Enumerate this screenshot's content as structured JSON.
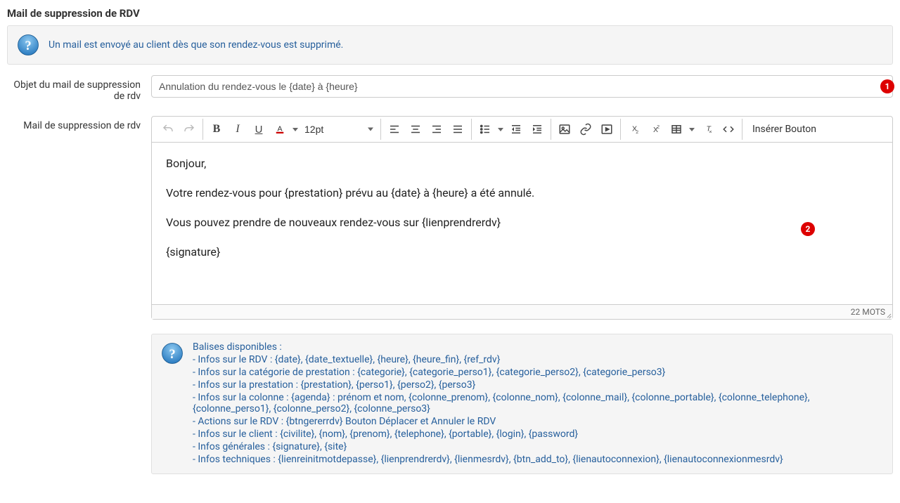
{
  "section_title": "Mail de suppression de RDV",
  "info1": "Un mail est envoyé au client dès que son rendez-vous est supprimé.",
  "labels": {
    "subject": "Objet du mail de suppression de rdv",
    "body": "Mail de suppression de rdv"
  },
  "subject_value": "Annulation du rendez-vous le {date} à {heure}",
  "editor": {
    "fontsize": "12pt",
    "insert_button": "Insérer Bouton",
    "content": {
      "p1": "Bonjour,",
      "p2": "Votre rendez-vous pour {prestation} prévu au {date} à {heure} a été annulé.",
      "p3": "Vous pouvez prendre de nouveaux rendez-vous sur {lienprendrerdv}",
      "p4": "{signature}"
    },
    "wordcount": "22 MOTS"
  },
  "badges": {
    "one": "1",
    "two": "2"
  },
  "tags": {
    "title": "Balises disponibles :",
    "l1": "- Infos sur le RDV : {date}, {date_textuelle}, {heure}, {heure_fin}, {ref_rdv}",
    "l2": "- Infos sur la catégorie de prestation : {categorie}, {categorie_perso1}, {categorie_perso2}, {categorie_perso3}",
    "l3": "- Infos sur la prestation : {prestation}, {perso1}, {perso2}, {perso3}",
    "l4": "- Infos sur la colonne : {agenda} : prénom et nom, {colonne_prenom}, {colonne_nom}, {colonne_mail}, {colonne_portable}, {colonne_telephone}, {colonne_perso1}, {colonne_perso2}, {colonne_perso3}",
    "l5": "- Actions sur le RDV : {btngererrdv} Bouton Déplacer et Annuler le RDV",
    "l6": "- Infos sur le client : {civilite}, {nom}, {prenom}, {telephone}, {portable}, {login}, {password}",
    "l7": "- Infos générales : {signature}, {site}",
    "l8": "- Infos techniques : {lienreinitmotdepasse}, {lienprendrerdv}, {lienmesrdv}, {btn_add_to}, {lienautoconnexion}, {lienautoconnexionmesrdv}"
  }
}
